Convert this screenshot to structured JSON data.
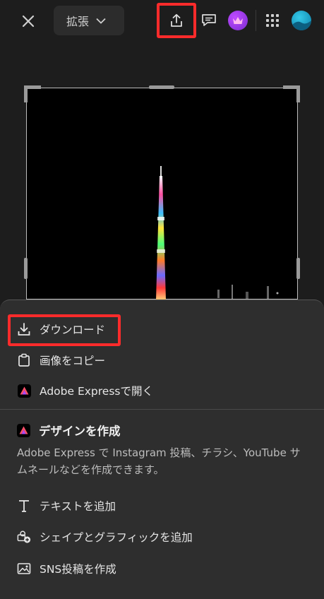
{
  "topbar": {
    "mode_label": "拡張",
    "icons": [
      "close-icon",
      "chevron-down-icon",
      "share-icon",
      "comment-icon",
      "crown-icon",
      "apps-grid-icon",
      "avatar"
    ]
  },
  "sheet": {
    "download_label": "ダウンロード",
    "copy_image_label": "画像をコピー",
    "open_express_label": "Adobe Expressで開く",
    "section_title": "デザインを作成",
    "section_desc": "Adobe Express で Instagram 投稿、チラシ、YouTube サムネールなどを作成できます。",
    "add_text_label": "テキストを追加",
    "add_shapes_label": "シェイプとグラフィックを追加",
    "create_sns_label": "SNS投稿を作成"
  },
  "colors": {
    "highlight": "#ff2b2b",
    "background": "#1d1d1d",
    "sheet": "#2e2e2e"
  }
}
